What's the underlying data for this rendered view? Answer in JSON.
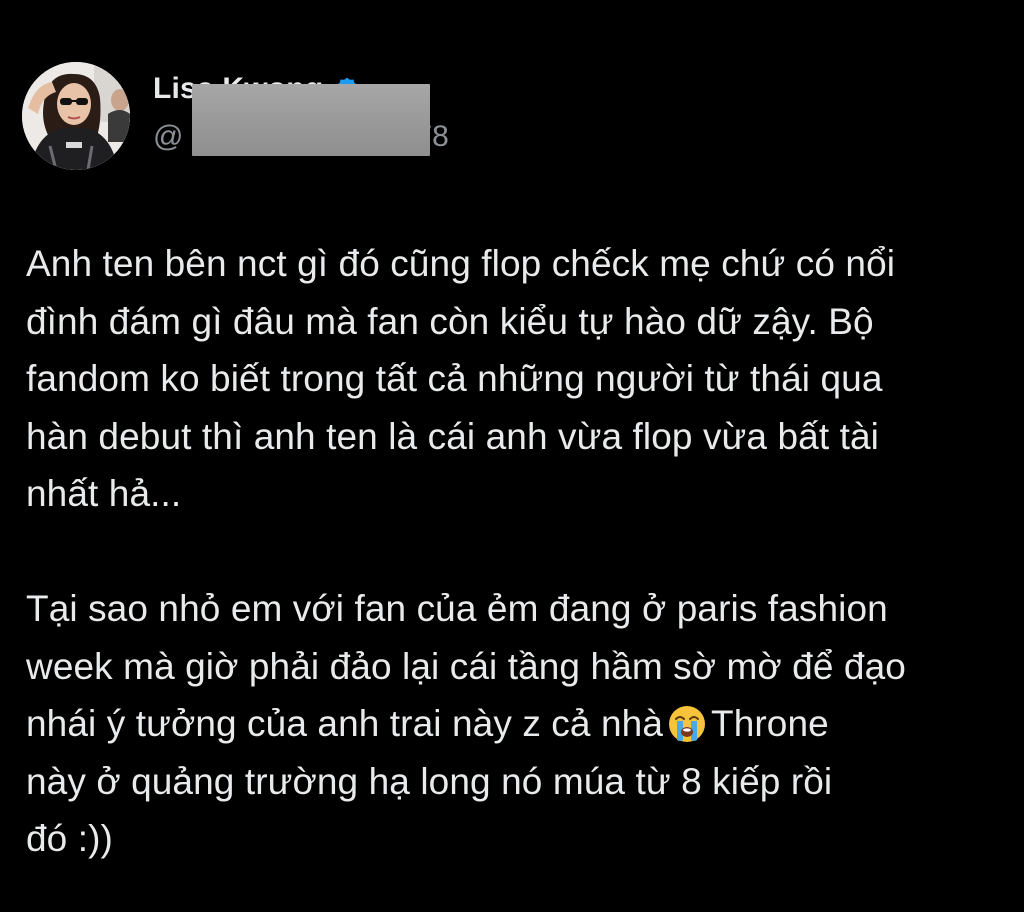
{
  "tweet": {
    "author": {
      "display_name": "Lisa Kwong",
      "handle_visible_suffix": "78",
      "handle_prefix": "@",
      "verified": true,
      "verified_color": "#1d9bf0"
    },
    "paragraphs": [
      {
        "text": "Anh ten bên nct gì đó cũng flop chếck mẹ chứ có nổi\nđình đám gì đâu mà fan còn kiểu tự hào dữ zậy. Bộ\nfandom ko biết trong tất cả những người từ thái qua\nhàn debut thì anh ten là cái anh vừa flop vừa bất tài\nnhất hả..."
      },
      {
        "text_before_emoji": "Tại sao nhỏ em với fan của ẻm đang ở paris fashion\nweek mà giờ phải đảo lại cái tầng hầm sờ mờ để đạo\nnhái ý tưởng của anh trai này z cả nhà",
        "emoji": "loudly-crying-face-icon",
        "text_after_emoji": "Throne\nnày ở quảng trường hạ long nó múa từ 8 kiếp rồi\nđó :))"
      }
    ]
  },
  "colors": {
    "background": "#000000",
    "text": "#e9eaeb",
    "secondary_text": "#8b9096",
    "redaction_box": "#9a9a9a"
  }
}
